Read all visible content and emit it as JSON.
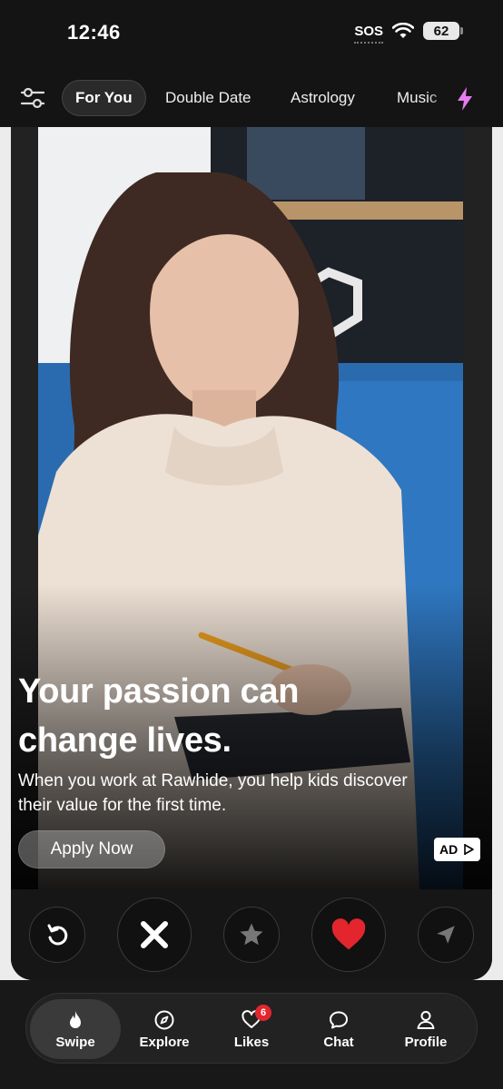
{
  "status_bar": {
    "time": "12:46",
    "carrier": "SOS",
    "battery": "62"
  },
  "tabs": [
    {
      "label": "For You",
      "active": true
    },
    {
      "label": "Double Date",
      "active": false
    },
    {
      "label": "Astrology",
      "active": false
    },
    {
      "label": "Music",
      "active": false
    }
  ],
  "ad": {
    "headline_line1": "Your passion can",
    "headline_line2": "change lives.",
    "body_line1": "When you work at Rawhide, you help kids discover",
    "body_line2": "their value for the first time.",
    "cta": "Apply Now",
    "badge": "AD"
  },
  "actions": [
    "rewind-icon",
    "close-icon",
    "star-icon",
    "heart-icon",
    "send-icon"
  ],
  "colors": {
    "accent": "#e3262e",
    "bolt": "#e77cf0",
    "background": "#141414"
  },
  "nav": {
    "items": [
      {
        "label": "Swipe",
        "icon": "flame-icon",
        "active": true
      },
      {
        "label": "Explore",
        "icon": "compass-icon",
        "active": false
      },
      {
        "label": "Likes",
        "icon": "heart-outline-icon",
        "active": false,
        "badge": "6"
      },
      {
        "label": "Chat",
        "icon": "chat-icon",
        "active": false
      },
      {
        "label": "Profile",
        "icon": "person-icon",
        "active": false
      }
    ]
  }
}
